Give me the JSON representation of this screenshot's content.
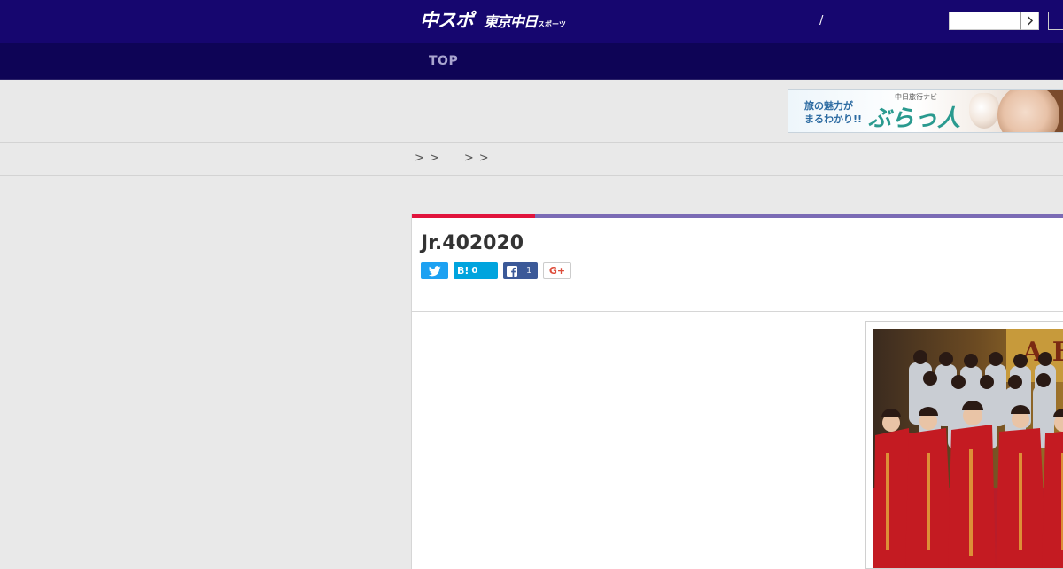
{
  "header": {
    "logo_main": "中スポ",
    "logo_sub": "東京中日",
    "logo_tiny": "スポーツ",
    "separator": "/",
    "search": {
      "value": "",
      "button_icon": "chevron-right-icon"
    }
  },
  "nav": {
    "items": [
      {
        "label": "TOP"
      }
    ]
  },
  "ad": {
    "line1": "旅の魅力が",
    "line2": "まるわかり!!",
    "small": "中日旅行ナビ",
    "brand": "ぶらっ人"
  },
  "breadcrumb": {
    "separators": [
      ">",
      ">",
      ">",
      ">"
    ]
  },
  "article": {
    "title": "Jr.402020",
    "share": {
      "twitter_icon": "twitter-bird-icon",
      "hatena_label": "B!",
      "hatena_count": "0",
      "facebook_icon": "facebook-f-icon",
      "facebook_count": "1",
      "gplus_label": "G+"
    }
  },
  "colors": {
    "header_bg": "#16066f",
    "nav_bg": "#0e0456",
    "accent_red": "#e1143c",
    "accent_purple": "#7b6bb5",
    "twitter": "#1da1f2",
    "hatena": "#00a4de",
    "facebook": "#3b5998",
    "gplus": "#dd4b39"
  }
}
